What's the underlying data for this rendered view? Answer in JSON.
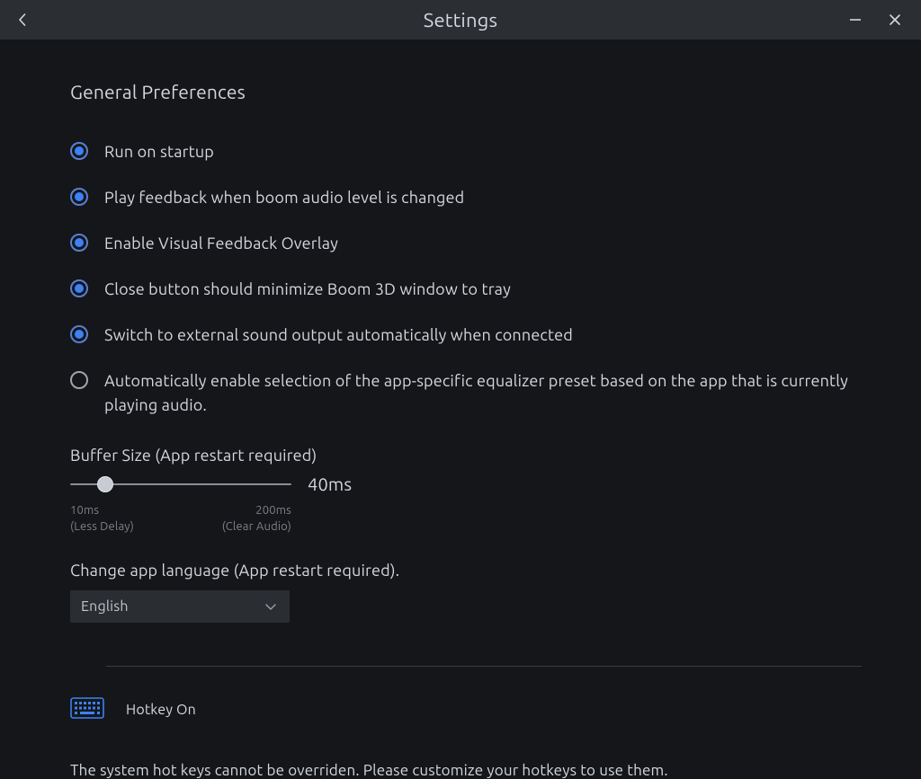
{
  "titlebar": {
    "title": "Settings"
  },
  "section": {
    "title": "General Preferences"
  },
  "options": [
    {
      "label": "Run on startup",
      "checked": true
    },
    {
      "label": "Play feedback when boom audio level is changed",
      "checked": true
    },
    {
      "label": "Enable Visual Feedback Overlay",
      "checked": true
    },
    {
      "label": "Close button should minimize Boom 3D window to tray",
      "checked": true
    },
    {
      "label": "Switch to external sound output automatically when connected",
      "checked": true
    },
    {
      "label": "Automatically enable selection of the app-specific equalizer preset based on the app that is currently playing audio.",
      "checked": false
    }
  ],
  "buffer": {
    "label": "Buffer Size (App restart required)",
    "value_label": "40ms",
    "min_ms": 10,
    "max_ms": 200,
    "value_ms": 40,
    "slider_percent": 15.8,
    "legend_min_line1": "10ms",
    "legend_min_line2": "(Less Delay)",
    "legend_max_line1": "200ms",
    "legend_max_line2": "(Clear Audio)"
  },
  "language": {
    "label": "Change app language (App restart required).",
    "selected": "English"
  },
  "hotkey": {
    "status": "Hotkey On",
    "note": "The system hot keys cannot be overriden. Please customize your hotkeys to use them."
  }
}
